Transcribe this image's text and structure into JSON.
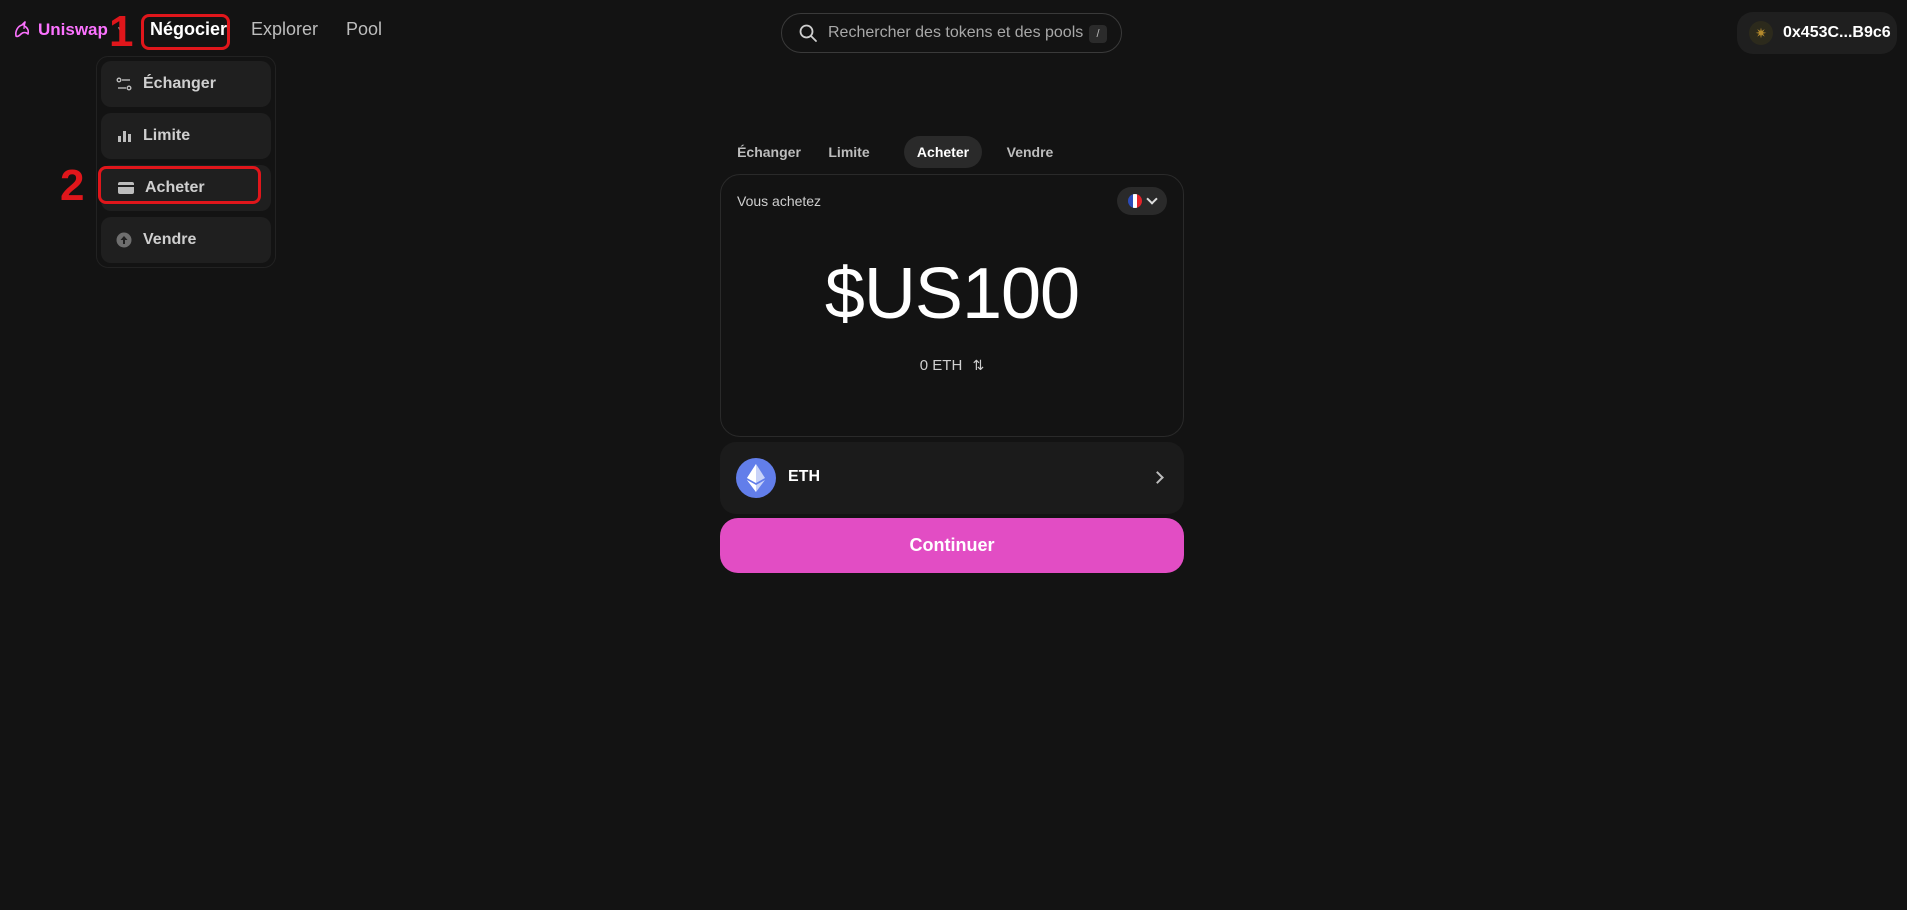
{
  "nav": {
    "brand": "Uniswap",
    "items": [
      {
        "label": "Négocier"
      },
      {
        "label": "Explorer"
      },
      {
        "label": "Pool"
      }
    ],
    "search_placeholder": "Rechercher des tokens et des pools",
    "search_shortcut": "/",
    "wallet_address": "0x453C...B9c6"
  },
  "annotations": [
    "1",
    "2"
  ],
  "dropdown": {
    "items": [
      {
        "label": "Échanger",
        "icon": "swap-icon"
      },
      {
        "label": "Limite",
        "icon": "bar-chart-icon"
      },
      {
        "label": "Acheter",
        "icon": "card-icon"
      },
      {
        "label": "Vendre",
        "icon": "arrow-up-circle-icon"
      }
    ]
  },
  "tabs": [
    {
      "label": "Échanger"
    },
    {
      "label": "Limite"
    },
    {
      "label": "Acheter",
      "active": true
    },
    {
      "label": "Vendre"
    }
  ],
  "buy": {
    "label": "Vous achetez",
    "amount": "$US100",
    "eth_amount": "0 ETH"
  },
  "token": {
    "symbol": "ETH"
  },
  "continue_label": "Continuer",
  "colors": {
    "accent": "#fc72ff",
    "button": "#e24dc4",
    "annotation": "#e0161b",
    "background": "#131313"
  }
}
